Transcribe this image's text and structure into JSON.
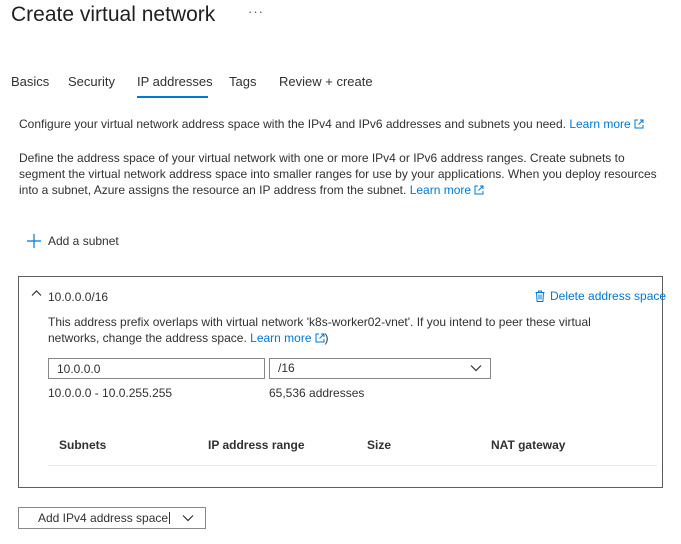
{
  "header": {
    "title": "Create virtual network",
    "more_label": "···"
  },
  "tabs": [
    {
      "label": "Basics"
    },
    {
      "label": "Security"
    },
    {
      "label": "IP addresses"
    },
    {
      "label": "Tags"
    },
    {
      "label": "Review + create"
    }
  ],
  "intro": {
    "line1_text": "Configure your virtual network address space with the IPv4 and IPv6 addresses and subnets you need.",
    "line1_link": "Learn more",
    "line2_text": "Define the address space of your virtual network with one or more IPv4 or IPv6 address ranges. Create subnets to segment the virtual network address space into smaller ranges for use by your applications. When you deploy resources into a subnet, Azure assigns the resource an IP address from the subnet.",
    "line2_link": "Learn more"
  },
  "add_subnet_label": "Add a subnet",
  "address_space": {
    "title": "10.0.0.0/16",
    "delete_label": "Delete address space",
    "warning_text": "This address prefix overlaps with virtual network 'k8s-worker02-vnet'. If you intend to peer these virtual networks, change the address space.",
    "warning_link": "Learn more",
    "warning_suffix": ")",
    "address_value": "10.0.0.0",
    "prefix_value": "/16",
    "range_text": "10.0.0.0 - 10.0.255.255",
    "count_text": "65,536 addresses",
    "subnet_columns": [
      "Subnets",
      "IP address range",
      "Size",
      "NAT gateway"
    ]
  },
  "add_space_button_label": "Add IPv4 address space",
  "colors": {
    "accent": "#0078d4",
    "text": "#323130",
    "border": "#605e5c"
  }
}
